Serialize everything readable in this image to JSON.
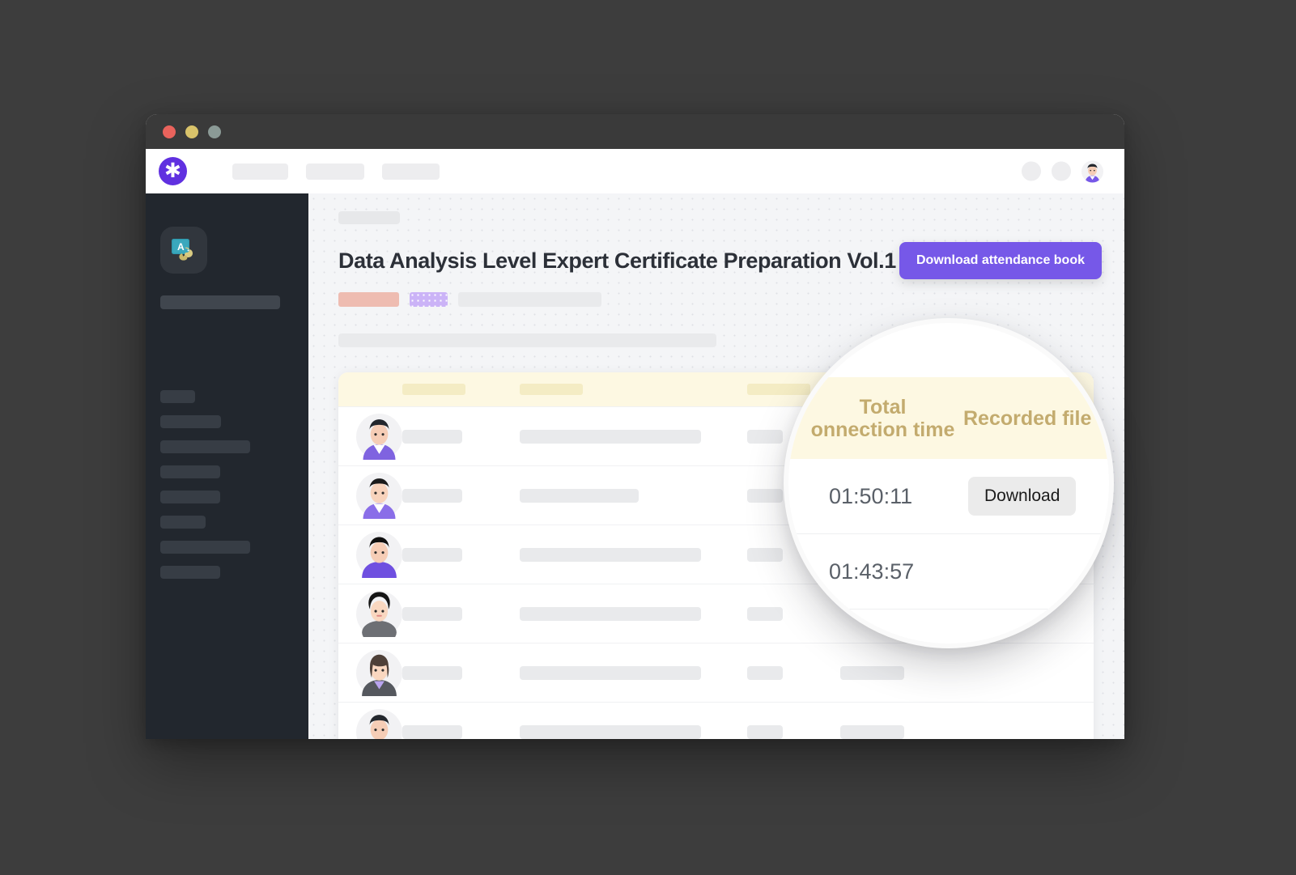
{
  "window": {
    "traffic_lights": [
      "close",
      "minimize",
      "maximize"
    ],
    "colors": {
      "close": "#e9635c",
      "minimize": "#d9c36a",
      "maximize": "#8b9a96"
    }
  },
  "topnav": {
    "logo_icon": "asterisk-logo-icon",
    "logo_glyph": "✱",
    "nav_placeholders": 3,
    "right_icons": [
      "circle-placeholder-icon",
      "circle-placeholder-icon",
      "user-avatar"
    ]
  },
  "sidebar": {
    "course_icon": "course-thumbnail-icon",
    "title_placeholder": true,
    "menu_placeholder_count": 7
  },
  "main": {
    "breadcrumb_placeholder": true,
    "page_title": "Data Analysis Level Expert Certificate Preparation Vol.1",
    "download_button_label": "Download attendance book",
    "accent_color": "#7658e8",
    "tags": [
      {
        "name": "tag-pink",
        "color": "#eebcb1"
      },
      {
        "name": "tag-purple",
        "color": "#cbb3f7"
      },
      {
        "name": "tag-gray",
        "color": "#e9eaec"
      }
    ],
    "description_placeholder": true
  },
  "table": {
    "header_background": "#fdf8e2",
    "header_placeholder_count": 4,
    "columns": [
      {
        "key": "avatar",
        "label": ""
      },
      {
        "key": "name",
        "label": ""
      },
      {
        "key": "email",
        "label": ""
      },
      {
        "key": "status",
        "label": ""
      },
      {
        "key": "extra",
        "label": ""
      }
    ],
    "rows": [
      {
        "avatar": "avatar-1",
        "has_extra": false
      },
      {
        "avatar": "avatar-2",
        "has_extra": false
      },
      {
        "avatar": "avatar-3",
        "has_extra": false
      },
      {
        "avatar": "avatar-4",
        "has_extra": false
      },
      {
        "avatar": "avatar-5",
        "has_extra": true
      },
      {
        "avatar": "avatar-6",
        "has_extra": true
      }
    ]
  },
  "magnifier": {
    "header_color": "#c3ab6e",
    "columns": [
      {
        "name": "total-connection-time",
        "label_line1": "Total",
        "label_line2": "onnection time"
      },
      {
        "name": "recorded-file",
        "label": "Recorded file"
      }
    ],
    "rows": [
      {
        "total_connection_time": "01:50:11",
        "action_label": "Download",
        "has_action": true
      },
      {
        "total_connection_time": "01:43:57",
        "action_label": "",
        "has_action": false
      }
    ]
  }
}
